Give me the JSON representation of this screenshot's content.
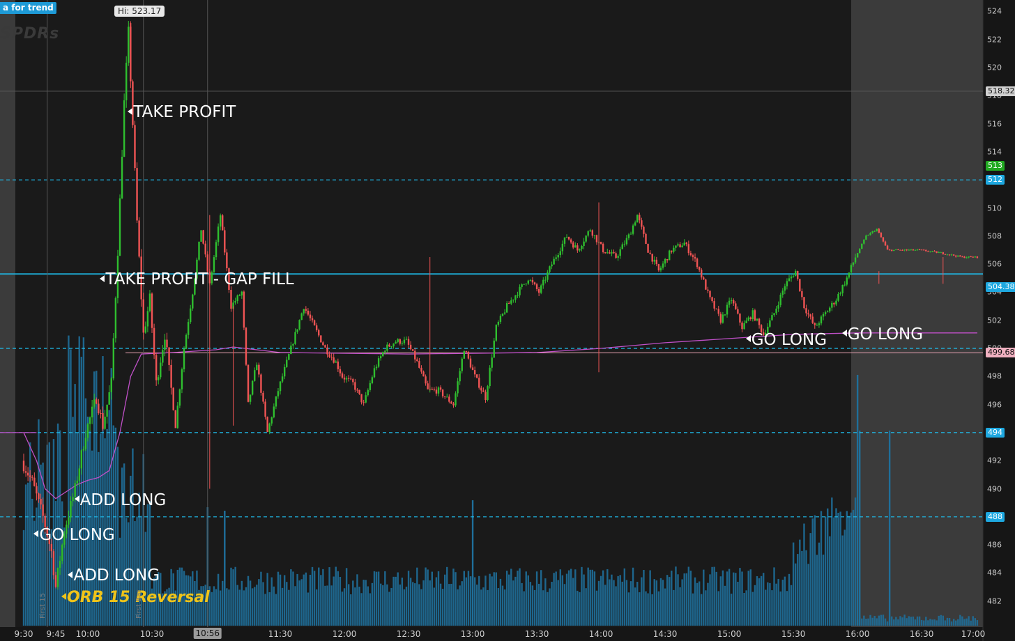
{
  "header": {
    "tag": "a for trend",
    "watermark": "SPDRs"
  },
  "chart_data": {
    "type": "candlestick",
    "title": "",
    "x_ticks": [
      "9:30",
      "9:45",
      "10:00",
      "10:30",
      "11:30",
      "12:00",
      "12:30",
      "13:00",
      "13:30",
      "14:00",
      "14:30",
      "15:00",
      "15:30",
      "16:00",
      "16:30",
      "17:00"
    ],
    "crosshair_time": "10:56",
    "y_ticks": [
      482,
      484,
      486,
      488,
      490,
      492,
      494,
      496,
      498,
      500,
      502,
      504,
      506,
      508,
      510,
      512,
      514,
      516,
      518,
      520,
      522,
      524
    ],
    "ylim": [
      480.5,
      525
    ],
    "high_label": "Hi: 523.17",
    "price_badges": [
      {
        "text": "518.32",
        "value": 518.32,
        "bg": "#d0d0d0",
        "fg": "#111"
      },
      {
        "text": "513",
        "value": 513.0,
        "bg": "#22aa22",
        "fg": "#fff"
      },
      {
        "text": "512",
        "value": 512.0,
        "bg": "#1ea8e0",
        "fg": "#fff"
      },
      {
        "text": "504.38",
        "value": 504.38,
        "bg": "#1ea8e0",
        "fg": "#fff"
      },
      {
        "text": "499.68",
        "value": 499.68,
        "bg": "#f0b0c0",
        "fg": "#111"
      },
      {
        "text": "494",
        "value": 494.0,
        "bg": "#1ea8e0",
        "fg": "#fff"
      },
      {
        "text": "488",
        "value": 488.0,
        "bg": "#1ea8e0",
        "fg": "#fff"
      }
    ],
    "levels": {
      "dashed": [
        512,
        500,
        494,
        488
      ],
      "solid_blue": 505.3,
      "pink": 499.68,
      "crosshair_price": 518.32
    },
    "annotations": [
      {
        "text": "TAKE PROFIT",
        "time": "10:20",
        "price": 516.8
      },
      {
        "text": "TAKE PROFIT - GAP FILL",
        "time": "10:07",
        "price": 504.9
      },
      {
        "text": "ADD  LONG",
        "time": "9:55",
        "price": 489.2
      },
      {
        "text": "GO LONG",
        "time": "9:36",
        "price": 486.7
      },
      {
        "text": "ADD  LONG",
        "time": "9:52",
        "price": 483.8
      },
      {
        "text": "GO LONG",
        "time": "15:09",
        "price": 500.6
      },
      {
        "text": "GO LONG",
        "time": "15:54",
        "price": 501.0
      }
    ],
    "orb_label": "ORB 15 Reversal",
    "vertical_markers": [
      "First 15",
      "First Bar"
    ],
    "colors": {
      "up": "#2fbf2f",
      "down": "#f05454",
      "vwap": "#c050c8",
      "volume": "#1f6f9a",
      "level": "#1ec0f0"
    },
    "price_path": [
      {
        "t": "9:30",
        "p": 492.0
      },
      {
        "t": "9:35",
        "p": 490.5
      },
      {
        "t": "9:40",
        "p": 488.0
      },
      {
        "t": "9:44",
        "p": 485.5
      },
      {
        "t": "9:46",
        "p": 483.0
      },
      {
        "t": "9:50",
        "p": 487.0
      },
      {
        "t": "9:55",
        "p": 490.0
      },
      {
        "t": "10:00",
        "p": 494.0
      },
      {
        "t": "10:05",
        "p": 496.5
      },
      {
        "t": "10:08",
        "p": 494.5
      },
      {
        "t": "10:12",
        "p": 497.5
      },
      {
        "t": "10:15",
        "p": 507.0
      },
      {
        "t": "10:17",
        "p": 514.0
      },
      {
        "t": "10:18",
        "p": 517.5
      },
      {
        "t": "10:20",
        "p": 522.5
      },
      {
        "t": "10:22",
        "p": 516.0
      },
      {
        "t": "10:24",
        "p": 509.0
      },
      {
        "t": "10:27",
        "p": 501.0
      },
      {
        "t": "10:30",
        "p": 503.5
      },
      {
        "t": "10:33",
        "p": 497.5
      },
      {
        "t": "10:37",
        "p": 501.0
      },
      {
        "t": "10:42",
        "p": 494.5
      },
      {
        "t": "10:46",
        "p": 500.0
      },
      {
        "t": "10:50",
        "p": 504.0
      },
      {
        "t": "10:54",
        "p": 508.5
      },
      {
        "t": "10:58",
        "p": 504.5
      },
      {
        "t": "11:03",
        "p": 509.5
      },
      {
        "t": "11:08",
        "p": 503.0
      },
      {
        "t": "11:13",
        "p": 504.0
      },
      {
        "t": "11:16",
        "p": 496.0
      },
      {
        "t": "11:20",
        "p": 499.0
      },
      {
        "t": "11:25",
        "p": 494.0
      },
      {
        "t": "11:30",
        "p": 497.0
      },
      {
        "t": "11:36",
        "p": 500.0
      },
      {
        "t": "11:42",
        "p": 503.0
      },
      {
        "t": "11:47",
        "p": 501.5
      },
      {
        "t": "11:52",
        "p": 500.0
      },
      {
        "t": "11:57",
        "p": 499.0
      },
      {
        "t": "12:00",
        "p": 498.0
      },
      {
        "t": "12:05",
        "p": 497.5
      },
      {
        "t": "12:10",
        "p": 496.0
      },
      {
        "t": "12:15",
        "p": 498.5
      },
      {
        "t": "12:20",
        "p": 500.0
      },
      {
        "t": "12:25",
        "p": 500.5
      },
      {
        "t": "12:30",
        "p": 500.5
      },
      {
        "t": "12:35",
        "p": 499.0
      },
      {
        "t": "12:40",
        "p": 497.0
      },
      {
        "t": "12:45",
        "p": 497.0
      },
      {
        "t": "12:52",
        "p": 496.0
      },
      {
        "t": "12:57",
        "p": 500.0
      },
      {
        "t": "13:02",
        "p": 498.0
      },
      {
        "t": "13:07",
        "p": 496.5
      },
      {
        "t": "13:12",
        "p": 501.5
      },
      {
        "t": "13:17",
        "p": 503.0
      },
      {
        "t": "13:22",
        "p": 504.0
      },
      {
        "t": "13:27",
        "p": 505.0
      },
      {
        "t": "13:32",
        "p": 504.0
      },
      {
        "t": "13:38",
        "p": 506.0
      },
      {
        "t": "13:45",
        "p": 508.0
      },
      {
        "t": "13:50",
        "p": 507.0
      },
      {
        "t": "13:56",
        "p": 508.5
      },
      {
        "t": "14:02",
        "p": 507.0
      },
      {
        "t": "14:08",
        "p": 506.5
      },
      {
        "t": "14:14",
        "p": 508.0
      },
      {
        "t": "14:18",
        "p": 509.5
      },
      {
        "t": "14:23",
        "p": 507.0
      },
      {
        "t": "14:28",
        "p": 505.5
      },
      {
        "t": "14:34",
        "p": 507.0
      },
      {
        "t": "14:40",
        "p": 507.5
      },
      {
        "t": "14:46",
        "p": 506.0
      },
      {
        "t": "14:52",
        "p": 503.5
      },
      {
        "t": "14:57",
        "p": 502.0
      },
      {
        "t": "15:02",
        "p": 503.5
      },
      {
        "t": "15:07",
        "p": 501.5
      },
      {
        "t": "15:12",
        "p": 502.5
      },
      {
        "t": "15:17",
        "p": 501.0
      },
      {
        "t": "15:22",
        "p": 502.5
      },
      {
        "t": "15:27",
        "p": 504.5
      },
      {
        "t": "15:32",
        "p": 505.5
      },
      {
        "t": "15:36",
        "p": 503.0
      },
      {
        "t": "15:41",
        "p": 501.5
      },
      {
        "t": "15:46",
        "p": 502.5
      },
      {
        "t": "15:51",
        "p": 503.5
      },
      {
        "t": "15:56",
        "p": 505.0
      },
      {
        "t": "16:00",
        "p": 506.5
      },
      {
        "t": "16:05",
        "p": 508.0
      },
      {
        "t": "16:10",
        "p": 508.5
      },
      {
        "t": "16:15",
        "p": 507.0
      },
      {
        "t": "16:22",
        "p": 507.0
      },
      {
        "t": "16:30",
        "p": 507.0
      },
      {
        "t": "16:40",
        "p": 506.8
      },
      {
        "t": "16:50",
        "p": 506.5
      },
      {
        "t": "16:56",
        "p": 506.5
      }
    ],
    "vwap_path": [
      {
        "t": "9:30",
        "p": 494.0
      },
      {
        "t": "9:36",
        "p": 492.0
      },
      {
        "t": "9:40",
        "p": 490.0
      },
      {
        "t": "9:45",
        "p": 489.3
      },
      {
        "t": "9:50",
        "p": 489.8
      },
      {
        "t": "9:55",
        "p": 490.3
      },
      {
        "t": "10:00",
        "p": 490.6
      },
      {
        "t": "10:05",
        "p": 490.8
      },
      {
        "t": "10:10",
        "p": 491.3
      },
      {
        "t": "10:15",
        "p": 494.0
      },
      {
        "t": "10:20",
        "p": 498.0
      },
      {
        "t": "10:25",
        "p": 499.6
      },
      {
        "t": "10:40",
        "p": 499.7
      },
      {
        "t": "11:00",
        "p": 499.9
      },
      {
        "t": "11:08",
        "p": 500.1
      },
      {
        "t": "11:30",
        "p": 499.7
      },
      {
        "t": "12:30",
        "p": 499.6
      },
      {
        "t": "13:30",
        "p": 499.7
      },
      {
        "t": "14:00",
        "p": 500.0
      },
      {
        "t": "14:30",
        "p": 500.4
      },
      {
        "t": "15:00",
        "p": 500.7
      },
      {
        "t": "15:30",
        "p": 501.0
      },
      {
        "t": "16:00",
        "p": 501.1
      },
      {
        "t": "16:56",
        "p": 501.1
      }
    ]
  }
}
